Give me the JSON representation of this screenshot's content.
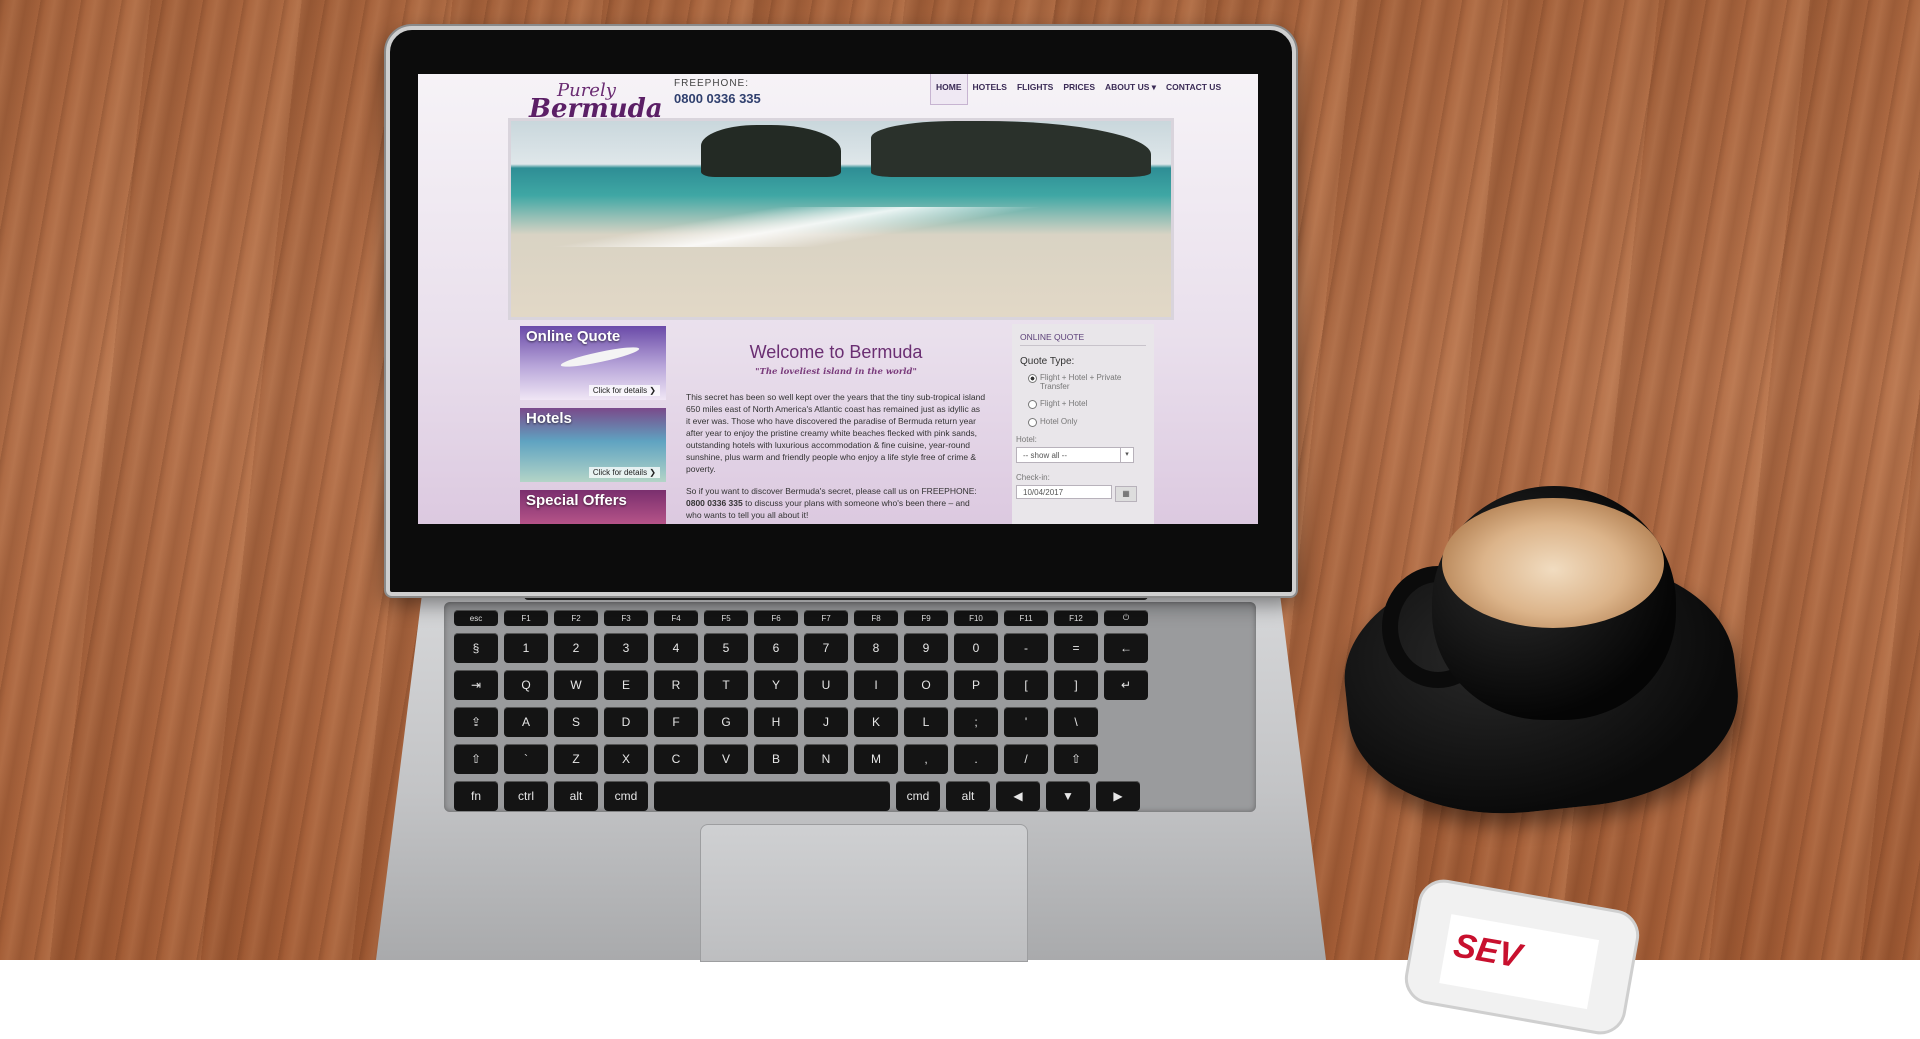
{
  "site": {
    "logo_top": "Purely",
    "logo_main": "Bermuda",
    "freephone_label": "FREEPHONE:",
    "freephone_number": "0800 0336 335",
    "nav": [
      "HOME",
      "HOTELS",
      "FLIGHTS",
      "PRICES",
      "ABOUT US ▾",
      "CONTACT US"
    ],
    "promos": [
      {
        "title": "Online Quote",
        "cta": "Click for details ❯"
      },
      {
        "title": "Hotels",
        "cta": "Click for details ❯"
      },
      {
        "title": "Special Offers",
        "cta": ""
      }
    ],
    "welcome": "Welcome to Bermuda",
    "tagline": "\"The loveliest island in the world\"",
    "para1": "This secret has been so well kept over the years that the tiny sub-tropical island 650 miles east of North America's Atlantic coast has remained just as idyllic as it ever was. Those who have discovered the paradise of Bermuda return year after year to enjoy the pristine creamy white beaches flecked with pink sands, outstanding hotels with luxurious accommodation & fine cuisine, year-round sunshine, plus warm and friendly people who enjoy a life style free of crime & poverty.",
    "para2_pre": "So if you want to discover Bermuda's secret, please call us on FREEPHONE: ",
    "para2_bold": "0800 0336 335",
    "para2_post": " to discuss your plans with someone who's been there – and who wants to tell you all about it!",
    "sidebar": {
      "heading": "ONLINE QUOTE",
      "quote_type_label": "Quote Type:",
      "options": [
        "Flight + Hotel + Private Transfer",
        "Flight + Hotel",
        "Hotel Only"
      ],
      "selected_option": 0,
      "hotel_label": "Hotel:",
      "hotel_value": "-- show all --",
      "checkin_label": "Check-in:",
      "checkin_value": "10/04/2017"
    }
  },
  "keyboard": {
    "function_row": [
      "esc",
      "F1",
      "F2",
      "F3",
      "F4",
      "F5",
      "F6",
      "F7",
      "F8",
      "F9",
      "F10",
      "F11",
      "F12",
      "⏻"
    ],
    "row1": [
      "§",
      "1",
      "2",
      "3",
      "4",
      "5",
      "6",
      "7",
      "8",
      "9",
      "0",
      "-",
      "=",
      "←"
    ],
    "row2": [
      "⇥",
      "Q",
      "W",
      "E",
      "R",
      "T",
      "Y",
      "U",
      "I",
      "O",
      "P",
      "[",
      "]",
      "↵"
    ],
    "row3": [
      "⇪",
      "A",
      "S",
      "D",
      "F",
      "G",
      "H",
      "J",
      "K",
      "L",
      ";",
      "'",
      "\\"
    ],
    "row4": [
      "⇧",
      "`",
      "Z",
      "X",
      "C",
      "V",
      "B",
      "N",
      "M",
      ",",
      ".",
      "/",
      "⇧"
    ],
    "row5": [
      "fn",
      "ctrl",
      "alt",
      "cmd",
      "",
      "cmd",
      "alt",
      "◀",
      "▼",
      "▶"
    ]
  },
  "phone": {
    "logo": "SEV"
  }
}
